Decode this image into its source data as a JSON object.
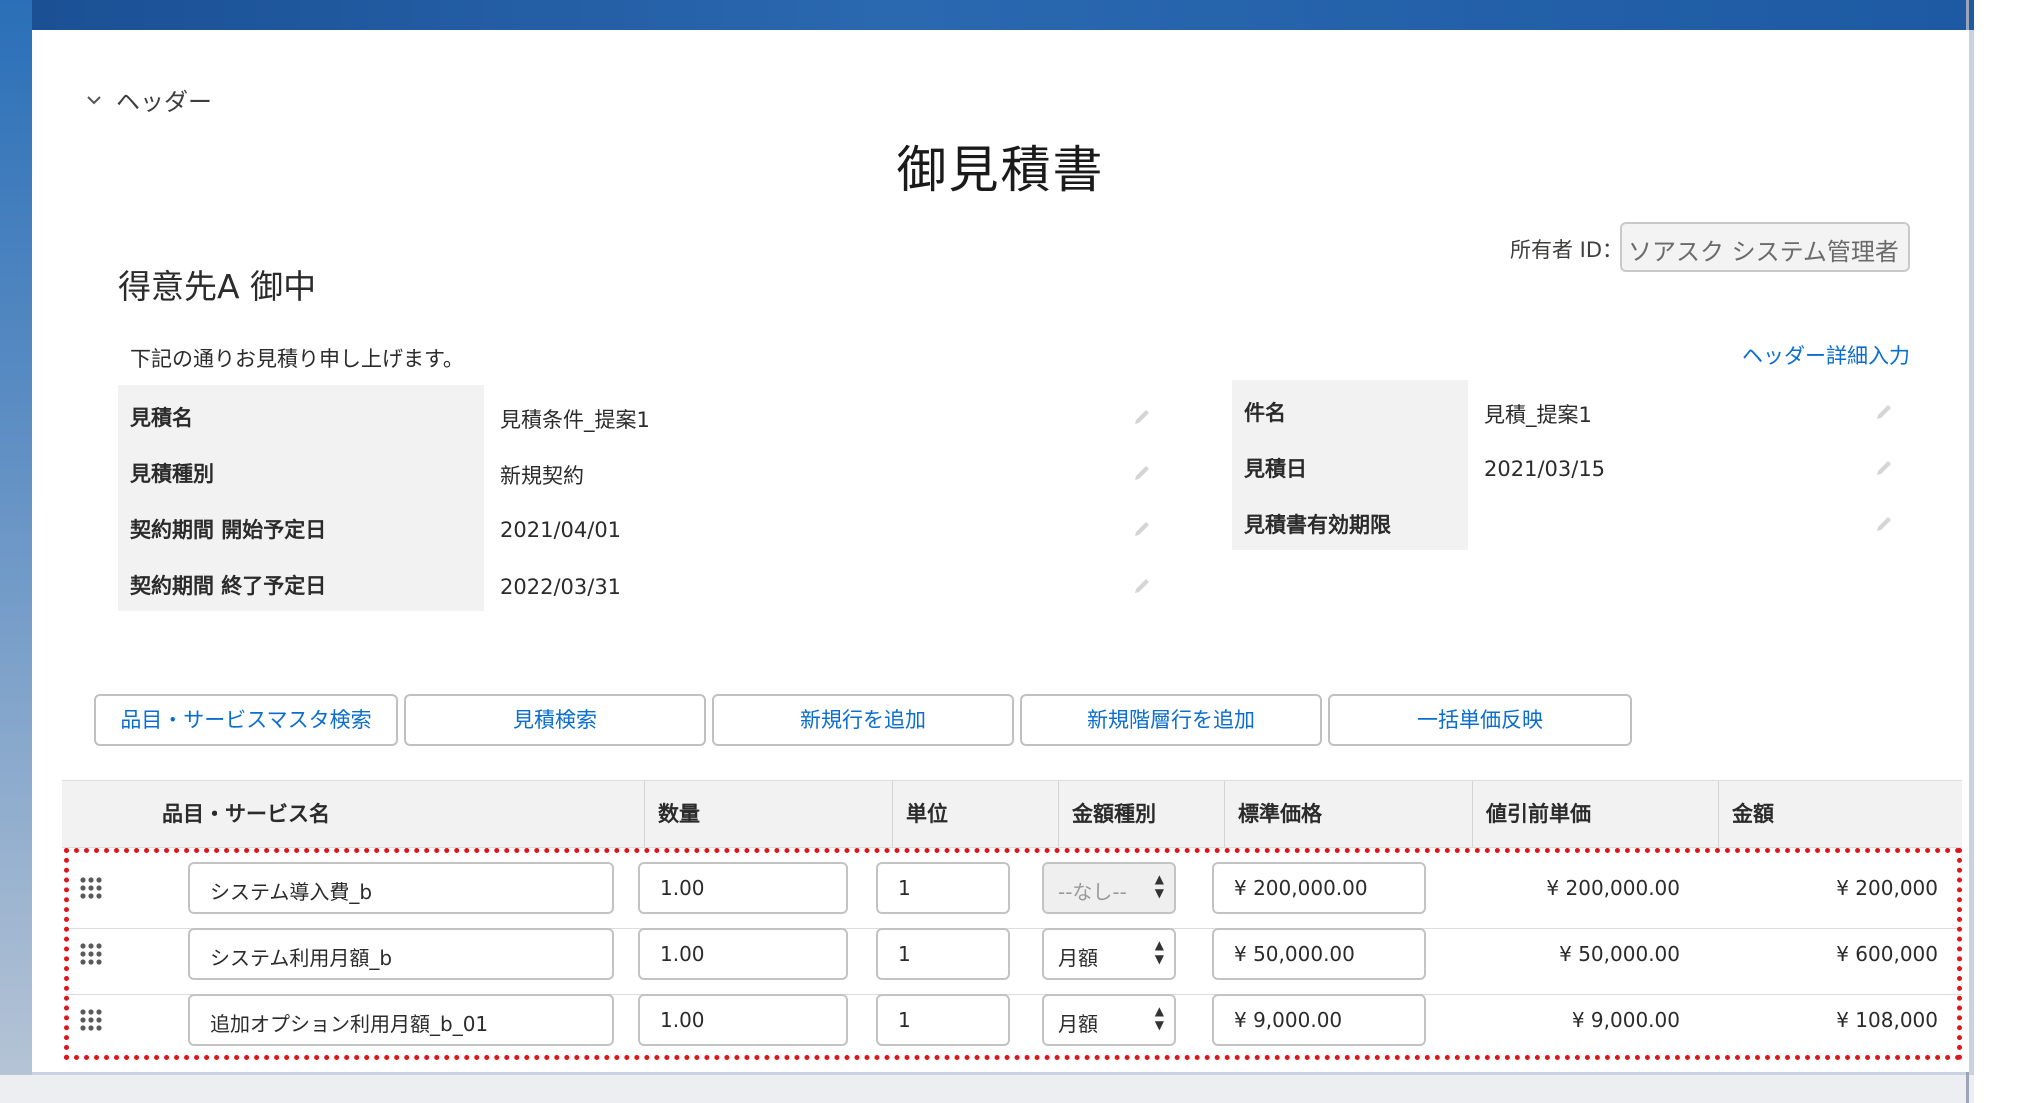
{
  "header_toggle": {
    "label": "ヘッダー"
  },
  "document_title": "御見積書",
  "owner": {
    "label": "所有者 ID：",
    "value": "ソアスク システム管理者"
  },
  "customer": "得意先A 御中",
  "intro_text": "下記の通りお見積り申し上げます。",
  "detail_link": "ヘッダー詳細入力",
  "left_fields": [
    {
      "label": "見積名",
      "value": "見積条件_提案1"
    },
    {
      "label": "見積種別",
      "value": "新規契約"
    },
    {
      "label": "契約期間 開始予定日",
      "value": "2021/04/01"
    },
    {
      "label": "契約期間 終了予定日",
      "value": "2022/03/31"
    }
  ],
  "right_fields": [
    {
      "label": "件名",
      "value": "見積_提案1"
    },
    {
      "label": "見積日",
      "value": "2021/03/15"
    },
    {
      "label": "見積書有効期限",
      "value": ""
    }
  ],
  "buttons": [
    "品目・サービスマスタ検索",
    "見積検索",
    "新規行を追加",
    "新規階層行を追加",
    "一括単価反映"
  ],
  "table": {
    "columns": [
      "品目・サービス名",
      "数量",
      "単位",
      "金額種別",
      "標準価格",
      "値引前単価",
      "金額"
    ],
    "rows": [
      {
        "name": "システム導入費_b",
        "qty": "1.00",
        "unit": "1",
        "amount_type": "--なし--",
        "amount_type_disabled": true,
        "std_price": "¥ 200,000.00",
        "pre_discount": "¥ 200,000.00",
        "amount": "¥ 200,000"
      },
      {
        "name": "システム利用月額_b",
        "qty": "1.00",
        "unit": "1",
        "amount_type": "月額",
        "amount_type_disabled": false,
        "std_price": "¥ 50,000.00",
        "pre_discount": "¥ 50,000.00",
        "amount": "¥ 600,000"
      },
      {
        "name": "追加オプション利用月額_b_01",
        "qty": "1.00",
        "unit": "1",
        "amount_type": "月額",
        "amount_type_disabled": false,
        "std_price": "¥ 9,000.00",
        "pre_discount": "¥ 9,000.00",
        "amount": "¥ 108,000"
      }
    ]
  },
  "colors": {
    "link": "#0a6ed1",
    "highlight_border": "#e0151b",
    "label_bg": "#f3f2f2"
  },
  "icons": {
    "toggle": "chevron-down-icon",
    "edit": "pencil-icon",
    "drag": "grip-icon",
    "select": "up-down-arrows-icon"
  }
}
